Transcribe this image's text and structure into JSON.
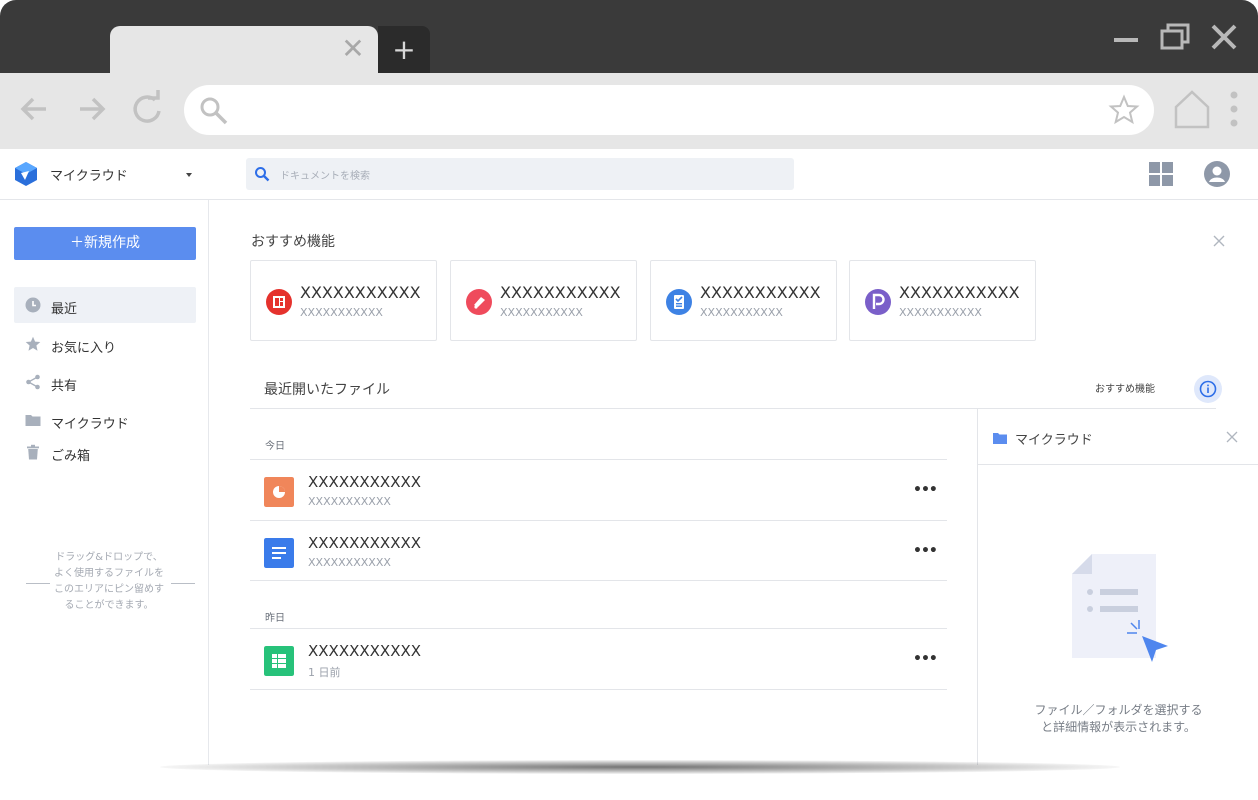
{
  "browser": {
    "tab_close": "✕",
    "new_tab": "+"
  },
  "app": {
    "brand": "マイクラウド",
    "search_placeholder": "ドキュメントを検索"
  },
  "sidebar": {
    "new_button": "＋新規作成",
    "items": [
      {
        "label": "最近",
        "icon": "clock-icon",
        "active": true
      },
      {
        "label": "お気に入り",
        "icon": "star-icon"
      },
      {
        "label": "共有",
        "icon": "share-icon"
      },
      {
        "label": "マイクラウド",
        "icon": "folder-icon"
      },
      {
        "label": "ごみ箱",
        "icon": "trash-icon"
      }
    ],
    "drop_hint": [
      "ドラッグ&ドロップで、",
      "よく使用するファイルを",
      "このエリアにピン留めす",
      "ることができます。"
    ]
  },
  "featured": {
    "title": "おすすめ機能",
    "cards": [
      {
        "title": "XXXXXXXXXXX",
        "subtitle": "XXXXXXXXXXX",
        "icon": "slides-app-icon",
        "color": "#e5322d"
      },
      {
        "title": "XXXXXXXXXXX",
        "subtitle": "XXXXXXXXXXX",
        "icon": "sign-app-icon",
        "color": "#ef4b5c"
      },
      {
        "title": "XXXXXXXXXXX",
        "subtitle": "XXXXXXXXXXX",
        "icon": "forms-app-icon",
        "color": "#3e82e4"
      },
      {
        "title": "XXXXXXXXXXX",
        "subtitle": "XXXXXXXXXXX",
        "icon": "reader-app-icon",
        "color": "#7a5fc9"
      }
    ]
  },
  "recent": {
    "title": "最近開いたファイル",
    "link": "おすすめ機能",
    "groups": [
      {
        "day": "今日",
        "files": [
          {
            "name": "XXXXXXXXXXX",
            "meta": "XXXXXXXXXXX",
            "icon": "presentation-file-icon",
            "color": "#f0865a"
          },
          {
            "name": "XXXXXXXXXXX",
            "meta": "XXXXXXXXXXX",
            "icon": "document-file-icon",
            "color": "#3a7bea"
          }
        ]
      },
      {
        "day": "昨日",
        "files": [
          {
            "name": "XXXXXXXXXXX",
            "meta": "1 日前",
            "icon": "spreadsheet-file-icon",
            "color": "#27c27a"
          }
        ]
      }
    ],
    "more": "•••"
  },
  "panel": {
    "title": "マイクラウド",
    "message": [
      "ファイル／フォルダを選択する",
      "と詳細情報が表示されます。"
    ]
  },
  "colors": {
    "accent": "#5b8def",
    "chrome_dark": "#3a3a3a",
    "chrome_light": "#e6e6e6"
  }
}
